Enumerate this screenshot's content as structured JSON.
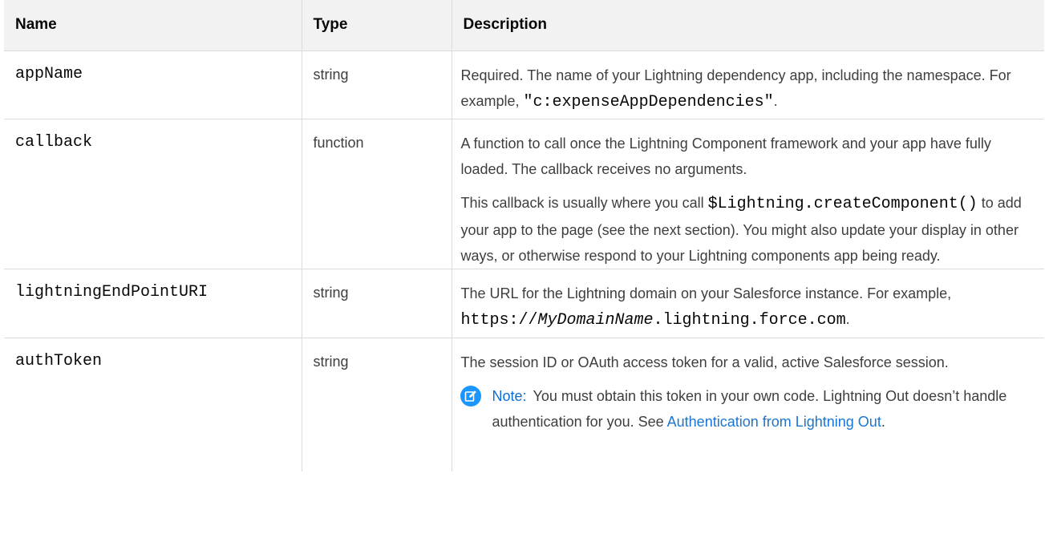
{
  "header": {
    "name": "Name",
    "type": "Type",
    "description": "Description"
  },
  "rows": [
    {
      "name": "appName",
      "type": "string",
      "desc_1a": "Required. The name of your Lightning dependency app, including the namespace. For example, ",
      "desc_1code": "\"c:expenseAppDependencies\"",
      "desc_1b": "."
    },
    {
      "name": "callback",
      "type": "function",
      "desc_1": "A function to call once the Lightning Component framework and your app have fully loaded. The callback receives no arguments.",
      "desc_2a": "This callback is usually where you call ",
      "desc_2code": "$Lightning.createComponent()",
      "desc_2b": " to add your app to the page (see the next section). You might also update your display in other ways, or otherwise respond to your Lightning components app being ready."
    },
    {
      "name": "lightningEndPointURI",
      "type": "string",
      "desc_1a": "The URL for the Lightning domain on your Salesforce instance. For example, ",
      "desc_code_a": "https://",
      "desc_code_it": "MyDomainName",
      "desc_code_b": ".lightning.force.com",
      "desc_1b": "."
    },
    {
      "name": "authToken",
      "type": "string",
      "desc_1": "The session ID or OAuth access token for a valid, active Salesforce session.",
      "note_label": "Note:",
      "note_text": "You must obtain this token in your own code. Lightning Out doesn’t handle authentication for you. See ",
      "note_link": "Authentication from Lightning Out",
      "note_end": "."
    }
  ],
  "icons": {
    "note": "edit-note-icon"
  },
  "colors": {
    "header_bg": "#f3f2f2",
    "note_icon": "#1b96ff",
    "note_label": "#0b6ed1",
    "link": "#1a76d2"
  }
}
